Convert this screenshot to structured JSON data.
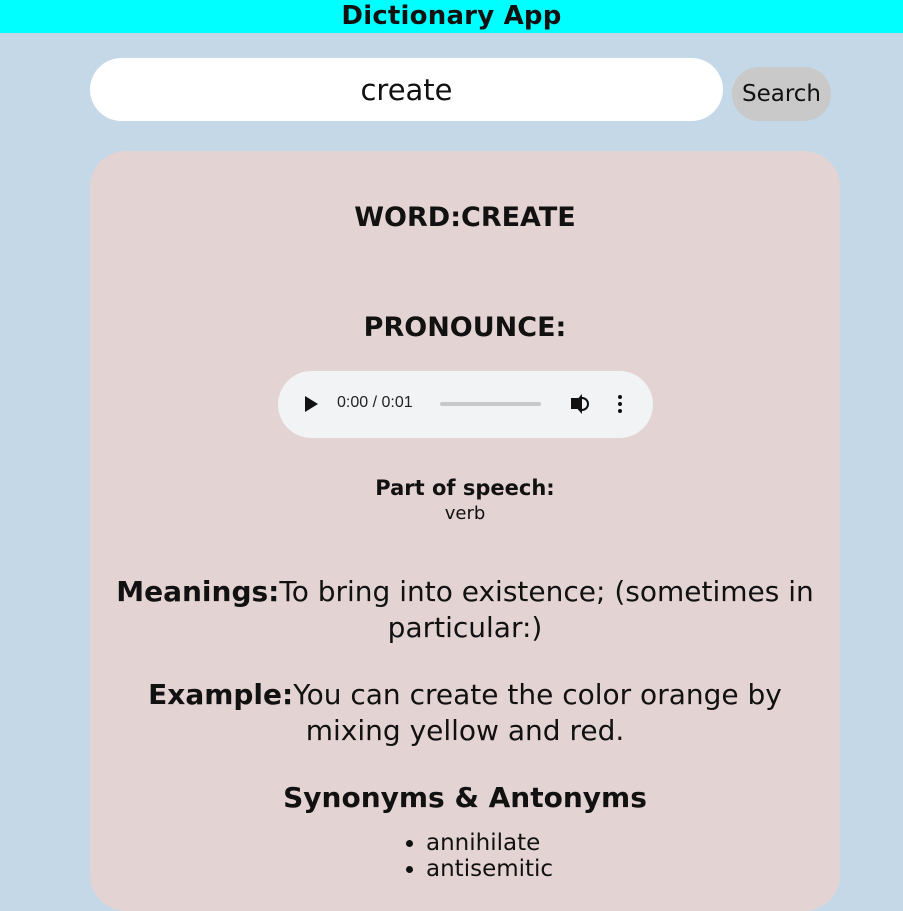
{
  "app": {
    "title": "Dictionary App"
  },
  "search": {
    "value": "create",
    "button_label": "Search"
  },
  "result": {
    "word_label": "WORD:",
    "word": "CREATE",
    "pronounce_label": "PRONOUNCE:",
    "audio": {
      "time": "0:00 / 0:01",
      "progress": 0
    },
    "part_of_speech_label": "Part of speech:",
    "part_of_speech": "verb",
    "meanings_label": "Meanings:",
    "meaning": "To bring into existence; (sometimes in particular:)",
    "example_label": "Example:",
    "example": "You can create the color orange by mixing yellow and red.",
    "synonyms_heading": "Synonyms & Antonyms",
    "synonyms": [
      "annihilate",
      "antisemitic"
    ]
  },
  "colors": {
    "topbar": "#00ffff",
    "page_bg": "#c5d8e8",
    "card_bg": "#e4d3d3",
    "search_button_bg": "#c9c9c9"
  },
  "icons": [
    "play-icon",
    "volume-icon",
    "more-options-icon"
  ]
}
